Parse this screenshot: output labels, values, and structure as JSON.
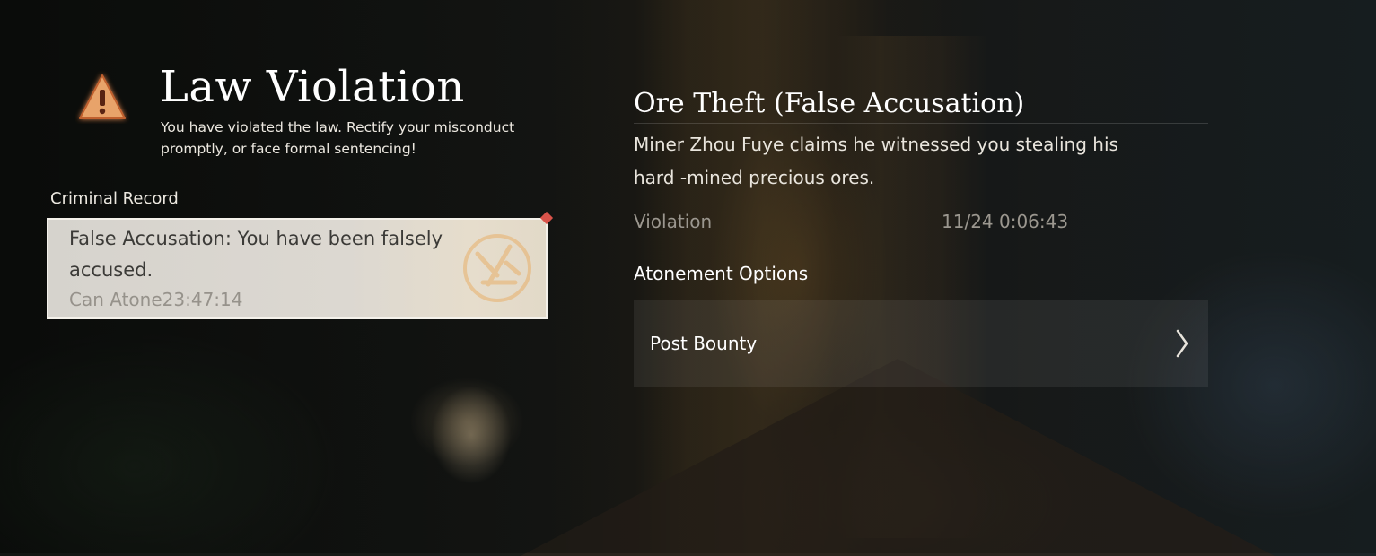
{
  "header": {
    "title": "Law Violation",
    "subtitle": "You have violated the law. Rectify your misconduct promptly, or face formal sentencing!",
    "icon": "warning-triangle-icon"
  },
  "record": {
    "section_label": "Criminal Record",
    "items": [
      {
        "text": "False Accusation: You have been falsely accused.",
        "timer_label": "Can Atone",
        "timer_value": "23:47:14",
        "selected": true
      }
    ]
  },
  "detail": {
    "title": "Ore Theft (False Accusation)",
    "description": "Miner Zhou Fuye claims he witnessed you stealing his hard -mined precious ores.",
    "violation_label": "Violation",
    "violation_time": "11/24 0:06:43",
    "atonement_label": "Atonement Options",
    "options": [
      {
        "label": "Post Bounty",
        "icon": "chevron-right-icon"
      }
    ]
  },
  "colors": {
    "accent_warning": "#e08a4a",
    "marker": "#d9534a",
    "card_bg": "#d6d3cd"
  }
}
